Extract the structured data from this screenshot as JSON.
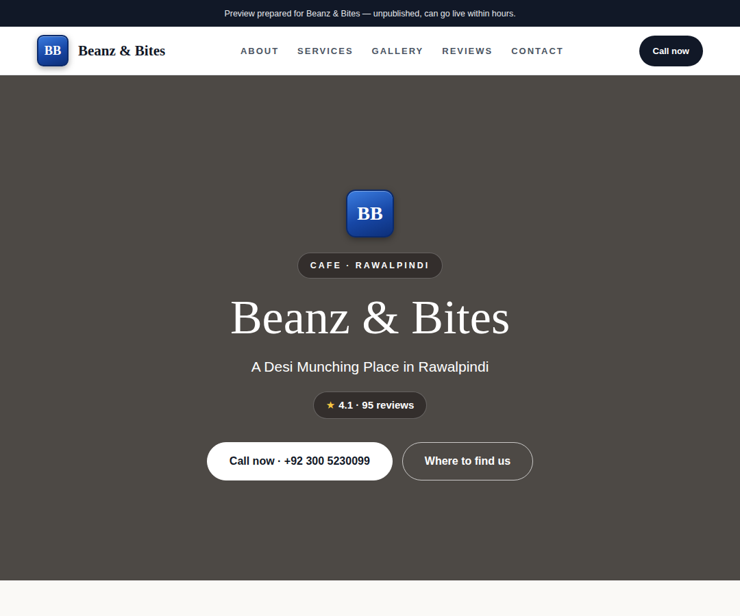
{
  "banner": {
    "text": "Preview prepared for Beanz & Bites — unpublished, can go live within hours."
  },
  "header": {
    "logo": "BB",
    "brand": "Beanz & Bites",
    "nav": [
      "ABOUT",
      "SERVICES",
      "GALLERY",
      "REVIEWS",
      "CONTACT"
    ],
    "cta": "Call now"
  },
  "hero": {
    "logo": "BB",
    "badge": "CAFE · RAWALPINDI",
    "title": "Beanz & Bites",
    "subtitle": "A Desi Munching Place in Rawalpindi",
    "rating": {
      "star": "★",
      "text": "4.1 · 95 reviews"
    },
    "buttons": [
      {
        "label": "Call now · +92 300 5230099",
        "kind": "primary"
      },
      {
        "label": "Where to find us",
        "kind": "outline"
      }
    ]
  }
}
